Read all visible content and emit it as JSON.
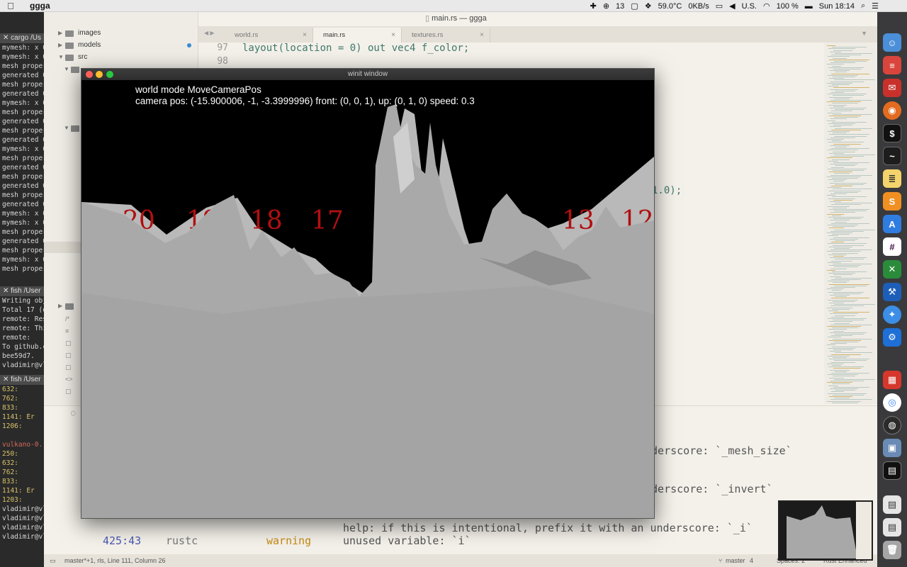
{
  "menubar": {
    "app_name": "ggga",
    "status_items": [
      "13",
      "59.0°C",
      "0KB/s",
      "U.S.",
      "100 %",
      "Sun 18:14"
    ]
  },
  "editor": {
    "window_title": "main.rs — ggga",
    "tabs": [
      {
        "label": "world.rs",
        "close": "×"
      },
      {
        "label": "main.rs",
        "close": "×"
      },
      {
        "label": "textures.rs",
        "close": "×"
      }
    ],
    "line_numbers": [
      "97",
      "98"
    ],
    "code_line_97": "layout(location = 0) out vec4 f_color;",
    "code_fragment": "1.0);",
    "sidebar": {
      "items": [
        {
          "label": "images"
        },
        {
          "label": "models"
        },
        {
          "label": "src"
        }
      ]
    },
    "output": {
      "lines": [
        "nderscore: `_mesh_size`",
        "nderscore: `_invert`",
        "help: if this is intentional, prefix it with an underscore: `_i`"
      ],
      "location": "425:43",
      "source": "rustc",
      "level": "warning",
      "message": "unused variable: `i`"
    },
    "status": {
      "left": "master*+1, rls, Line 111, Column 26",
      "branch": "master",
      "branch_count": "4",
      "spaces": "Spaces: 2",
      "syntax": "Rust Enhanced"
    }
  },
  "terminal": {
    "tab1": "cargo /Us",
    "tab2": "fish /User",
    "tab3": "fish /User",
    "lines1": [
      "mymesh: x 0",
      "mymesh: x 0",
      "mesh proper",
      "generated 0",
      "mesh proper",
      "generated 0",
      "mymesh: x 0",
      "mesh proper",
      "generated 0",
      "mesh proper",
      "generated 0",
      "mymesh: x 0",
      "mesh proper",
      "generated 0",
      "mesh proper",
      "generated 0",
      "mesh proper",
      "generated 0",
      "mymesh: x 0",
      "mymesh: x 0",
      "mesh proper",
      "generated 0",
      "mesh proper",
      "mymesh: x 0",
      "mesh proper"
    ],
    "lines2": [
      "Writing obj",
      "Total 17 (d",
      "remote: Res",
      "remote: Thi",
      "remote:",
      "To github.c",
      "  bee59d7.",
      "vladimir@vl"
    ],
    "lines3": [
      "632:",
      "762:",
      "833:",
      "1141:  Er",
      "1206:",
      "",
      "vulkano-0.",
      "250:",
      "632:",
      "762:",
      "833:",
      "1141:  Er",
      "1203:",
      "vladimir@vl",
      "vladimir@vl",
      "vladimir@vl",
      "vladimir@vl"
    ]
  },
  "winit": {
    "title": "winit window",
    "hud_line1": "world mode MoveCameraPos",
    "hud_line2": "camera pos: (-15.900006, -1, -3.3999996) front: (0, 0, 1), up: (0, 1, 0) speed: 0.3",
    "billboard_numbers": [
      "20",
      "19",
      "18",
      "17",
      "13",
      "12"
    ]
  }
}
